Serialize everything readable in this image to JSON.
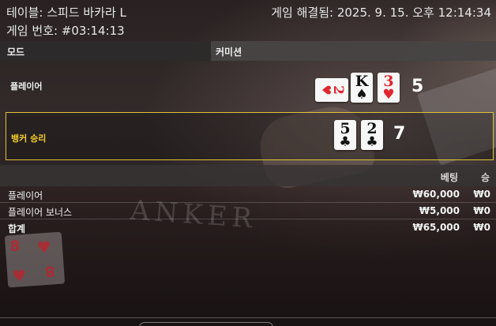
{
  "header": {
    "table_title": "테이블: 스피드 바카라 L",
    "round_number": "게임 번호: #03:14:13",
    "resolved_at": "게임 해결됨: 2025. 9. 15. 오후 12:14:34"
  },
  "mode": {
    "label": "모드",
    "value": "커미션"
  },
  "player": {
    "label": "플레이어",
    "score": "5",
    "cards": [
      {
        "rank": "2",
        "suit": "♥",
        "color": "red",
        "orientation": "sideways"
      },
      {
        "rank": "K",
        "suit": "♠",
        "color": "black",
        "orientation": "upright"
      },
      {
        "rank": "3",
        "suit": "♥",
        "color": "red",
        "orientation": "upright"
      }
    ]
  },
  "banker": {
    "label": "뱅커 승리",
    "score": "7",
    "highlight_color": "#e1c23a",
    "cards": [
      {
        "rank": "5",
        "suit": "♣",
        "color": "black",
        "orientation": "upright"
      },
      {
        "rank": "2",
        "suit": "♣",
        "color": "black",
        "orientation": "upright"
      }
    ]
  },
  "bets": {
    "columns": {
      "bet": "베팅",
      "win": "승"
    },
    "rows": [
      {
        "name": "플레이어",
        "bet": "₩60,000",
        "win": "₩0"
      },
      {
        "name": "플레이어 보너스",
        "bet": "₩5,000",
        "win": "₩0"
      }
    ],
    "total": {
      "name": "합계",
      "bet": "₩65,000",
      "win": "₩0"
    }
  },
  "background_text": "ANKER"
}
